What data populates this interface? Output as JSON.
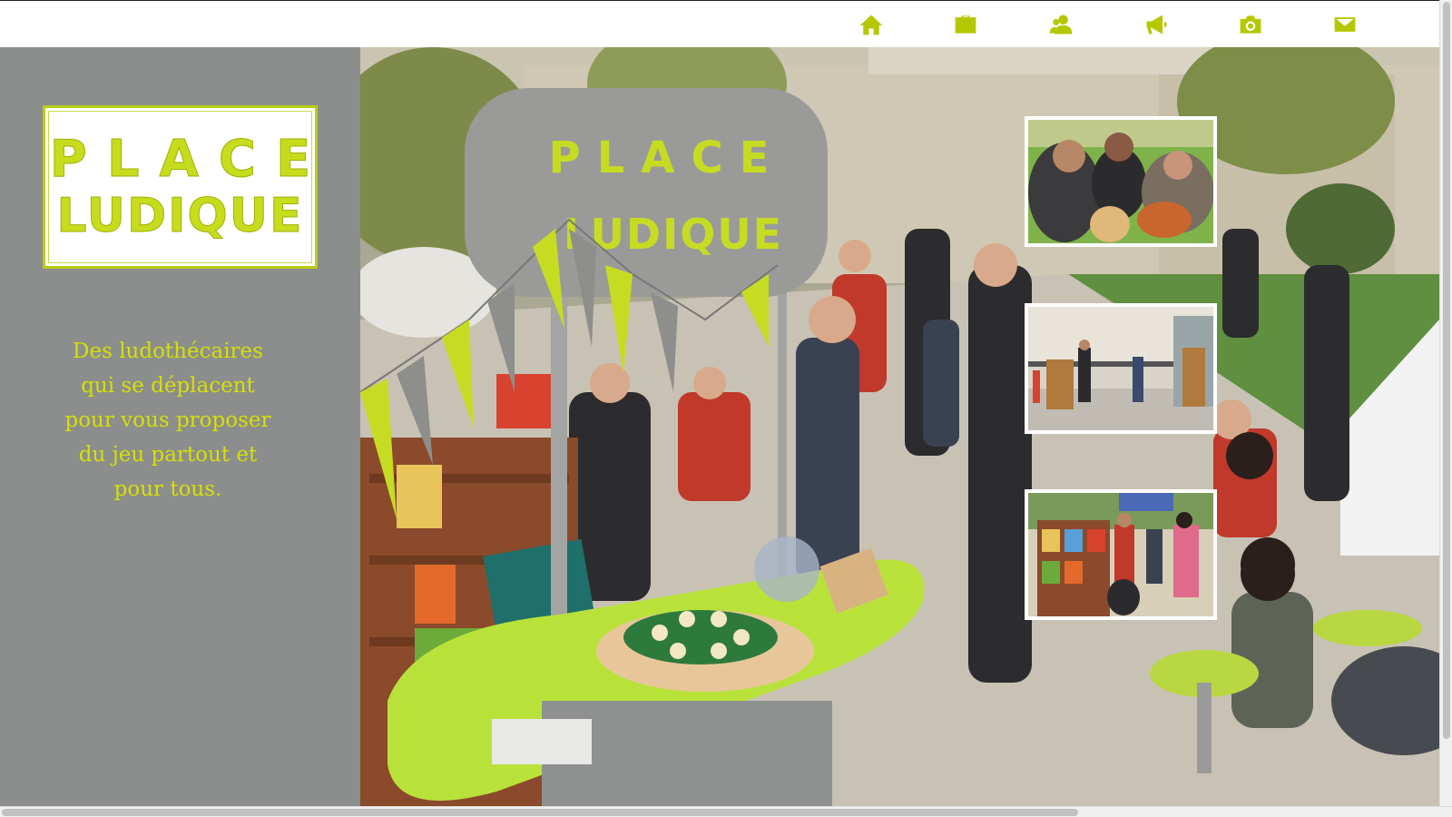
{
  "nav": {
    "items": [
      {
        "icon": "home-icon",
        "label": ""
      },
      {
        "icon": "briefcase-icon",
        "label": ""
      },
      {
        "icon": "users-icon",
        "label": ""
      },
      {
        "icon": "megaphone-icon",
        "label": ""
      },
      {
        "icon": "camera-icon",
        "label": ""
      },
      {
        "icon": "mail-icon",
        "label": ""
      }
    ],
    "icon_color": "#b4c800"
  },
  "sidebar": {
    "background": "#8c8e8d",
    "logo": {
      "line1": "PLACE",
      "line2": "LUDIQUE",
      "color": "#c8dc1e"
    },
    "tagline": {
      "line1": "Des ludothécaires",
      "line2": "qui se déplacent",
      "line3": "pour vous proposer",
      "line4": "du jeu partout et",
      "line5": "pour tous."
    },
    "tagline_color": "#d6e000"
  },
  "hero": {
    "sign_line1": "PLACE",
    "sign_line2": "LUDIQUE"
  },
  "thumbnails": [
    {
      "name": "thumbnail-players"
    },
    {
      "name": "thumbnail-street-games"
    },
    {
      "name": "thumbnail-game-shelves"
    }
  ]
}
